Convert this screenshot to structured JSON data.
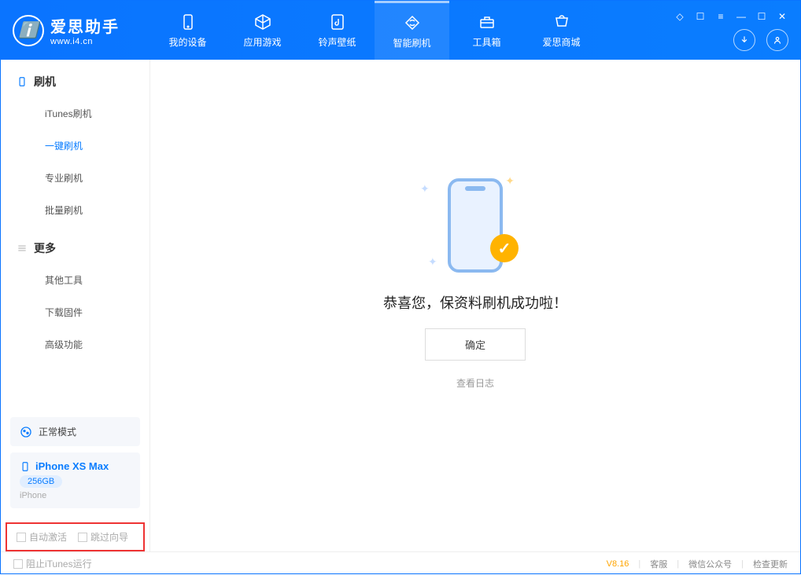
{
  "app": {
    "name_cn": "爱思助手",
    "name_en": "www.i4.cn"
  },
  "header_tabs": [
    {
      "label": "我的设备",
      "icon": "phone-icon"
    },
    {
      "label": "应用游戏",
      "icon": "cube-icon"
    },
    {
      "label": "铃声壁纸",
      "icon": "music-icon"
    },
    {
      "label": "智能刷机",
      "icon": "refresh-icon",
      "active": true
    },
    {
      "label": "工具箱",
      "icon": "toolbox-icon"
    },
    {
      "label": "爱思商城",
      "icon": "cart-icon"
    }
  ],
  "sidebar": {
    "section1_title": "刷机",
    "section1_items": [
      {
        "label": "iTunes刷机"
      },
      {
        "label": "一键刷机",
        "active": true
      },
      {
        "label": "专业刷机"
      },
      {
        "label": "批量刷机"
      }
    ],
    "section2_title": "更多",
    "section2_items": [
      {
        "label": "其他工具"
      },
      {
        "label": "下载固件"
      },
      {
        "label": "高级功能"
      }
    ]
  },
  "device": {
    "mode": "正常模式",
    "name": "iPhone XS Max",
    "storage": "256GB",
    "type": "iPhone"
  },
  "options": {
    "auto_activate": "自动激活",
    "skip_guide": "跳过向导"
  },
  "main": {
    "success_message": "恭喜您，保资料刷机成功啦！",
    "ok_button": "确定",
    "view_log": "查看日志"
  },
  "footer": {
    "block_itunes": "阻止iTunes运行",
    "version": "V8.16",
    "links": [
      "客服",
      "微信公众号",
      "检查更新"
    ]
  }
}
